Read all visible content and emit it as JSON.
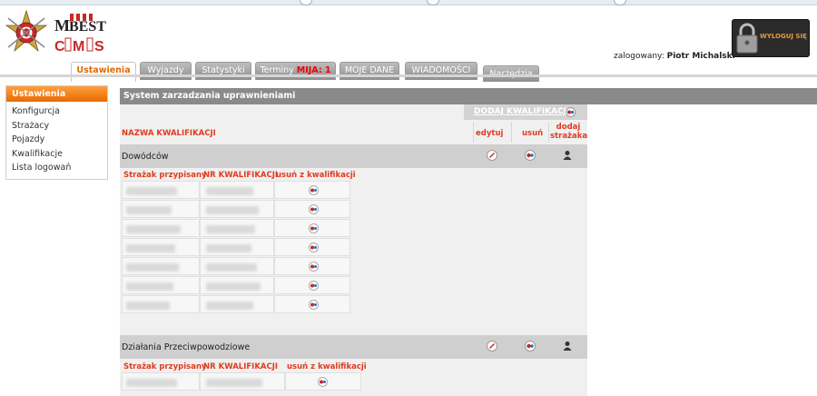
{
  "header": {
    "logo_text": "MBEST CMS",
    "logged_in_label": "zalogowany:",
    "logged_in_user": "Piotr Michalski",
    "logout_label": "WYLOGUJ SIĘ"
  },
  "tabs": [
    {
      "label": "Ustawienia",
      "active": true
    },
    {
      "label": "Wyjazdy"
    },
    {
      "label": "Statystyki"
    },
    {
      "label": "Terminy",
      "alert": "MIJA: 1"
    },
    {
      "label": "MOJE DANE"
    },
    {
      "label": "WIADOMOŚCI"
    },
    {
      "label": "Narzędzia"
    }
  ],
  "sidebar": {
    "header": "Ustawienia",
    "items": [
      "Konfigurcja",
      "Strażacy",
      "Pojazdy",
      "Kwalifikacje",
      "Lista logowań"
    ]
  },
  "main": {
    "title": "System zarzadzania uprawnieniami",
    "add_link": "DODAJ KWALIFIKACJI",
    "columns": {
      "name": "NAZWA KWALIFIKACJI",
      "edit": "edytuj",
      "delete": "usuń",
      "add_firefighter": "dodaj strażaka"
    },
    "sub_columns": {
      "firefighter": "Strażak przypisany",
      "number": "NR KWALIFIKACJI",
      "remove": "usuń z kwalifikacji"
    },
    "qualifications": [
      {
        "name": "Dowódców"
      },
      {
        "name": "Działania Przeciwpowodziowe"
      }
    ]
  },
  "colors": {
    "accent": "#e06a00",
    "label_red": "#e03b1f",
    "title_bar": "#8a8a8a"
  },
  "icons": [
    "edit-icon",
    "delete-icon",
    "add-person-icon",
    "lock-icon"
  ]
}
